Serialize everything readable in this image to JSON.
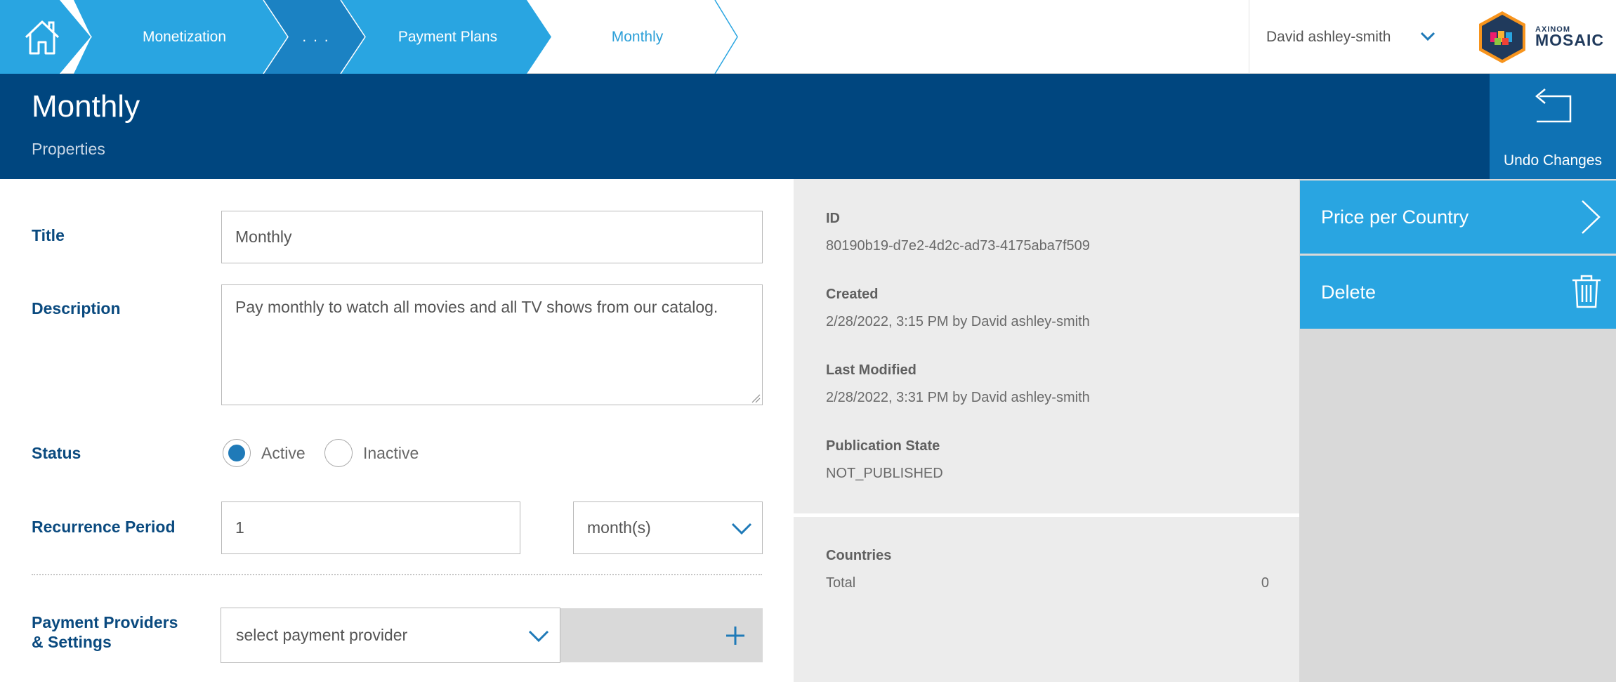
{
  "breadcrumb": {
    "home_icon": "home-icon",
    "items": [
      {
        "label": "Monetization"
      },
      {
        "label": ". . ."
      },
      {
        "label": "Payment Plans"
      },
      {
        "label": "Monthly"
      }
    ],
    "colors": {
      "level1": "#29a5e1",
      "level2": "#1b82c3",
      "current_text": "#2b9fd8"
    }
  },
  "user": {
    "name": "David ashley-smith",
    "menu_icon": "chevron-down-icon"
  },
  "logo": {
    "small": "AXINOM",
    "big": "MOSAIC"
  },
  "header": {
    "title": "Monthly",
    "subtitle": "Properties",
    "undo_label": "Undo Changes",
    "undo_icon": "undo-icon",
    "background": "#00467f"
  },
  "form": {
    "title": {
      "label": "Title",
      "value": "Monthly"
    },
    "description": {
      "label": "Description",
      "value": "Pay monthly to watch all movies and all TV shows from our catalog."
    },
    "status": {
      "label": "Status",
      "options": [
        {
          "label": "Active",
          "selected": true
        },
        {
          "label": "Inactive",
          "selected": false
        }
      ]
    },
    "recurrence": {
      "label": "Recurrence Period",
      "value": "1",
      "unit": "month(s)"
    },
    "payment_providers": {
      "label_line1": "Payment Providers",
      "label_line2": "& Settings",
      "placeholder": "select payment provider",
      "add_icon": "plus-icon"
    }
  },
  "info": {
    "id": {
      "label": "ID",
      "value": "80190b19-d7e2-4d2c-ad73-4175aba7f509"
    },
    "created": {
      "label": "Created",
      "value": "2/28/2022, 3:15 PM by David ashley-smith"
    },
    "modified": {
      "label": "Last Modified",
      "value": "2/28/2022, 3:31 PM by David ashley-smith"
    },
    "publication": {
      "label": "Publication State",
      "value": "NOT_PUBLISHED"
    },
    "countries": {
      "label": "Countries",
      "total_label": "Total",
      "total_value": "0"
    }
  },
  "actions": [
    {
      "label": "Price per Country",
      "icon": "chevron-right-icon"
    },
    {
      "label": "Delete",
      "icon": "trash-icon"
    }
  ],
  "accent_color": "#29a5e1"
}
